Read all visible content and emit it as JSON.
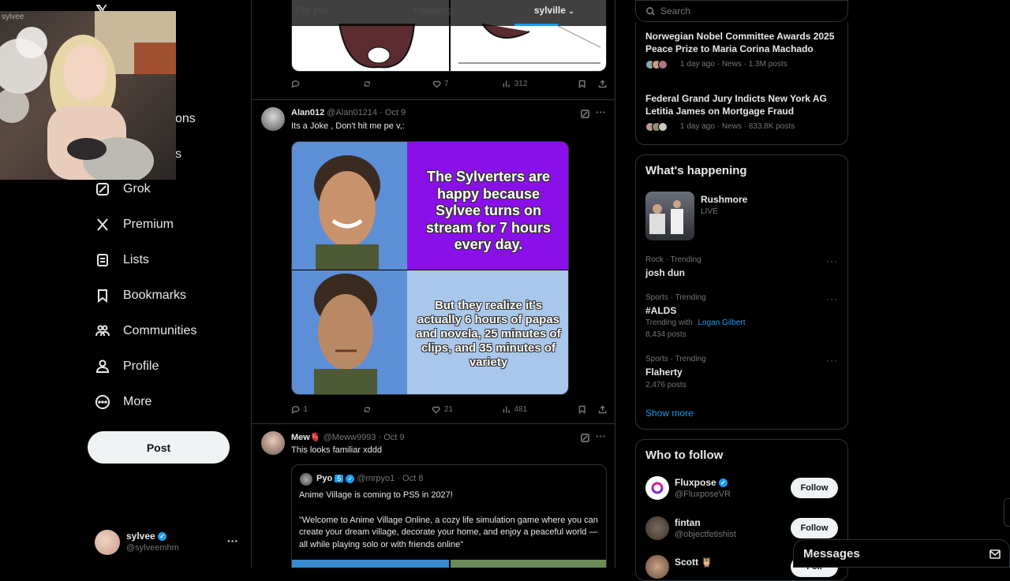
{
  "webcam": {
    "label": "sylvee"
  },
  "nav": {
    "items": [
      {
        "label": "Grok"
      },
      {
        "label": "Premium"
      },
      {
        "label": "Lists"
      },
      {
        "label": "Bookmarks"
      },
      {
        "label": "Communities"
      },
      {
        "label": "Profile"
      },
      {
        "label": "More"
      }
    ],
    "partial_1": "ons",
    "partial_2": "s",
    "post_label": "Post",
    "account": {
      "name": "sylvee",
      "handle": "@sylveemhm",
      "more": "···"
    }
  },
  "feed": {
    "tabs": [
      {
        "label": "For you"
      },
      {
        "label": "Following"
      },
      {
        "label": "sylville"
      }
    ],
    "top_actions": {
      "likes": "7",
      "views": "312"
    },
    "tweet1": {
      "name": "Alan012",
      "handle": "@Alan01214",
      "date": "· Oct 9",
      "text": "Its a Joke , Don't hit me pe v,:",
      "meme_top": "The Sylverters are happy because Sylvee turns on stream for 7 hours every day.",
      "meme_bottom": "But they realize it's actually 6 hours of papas and novela, 25 minutes of clips, and 35 minutes of variety",
      "replies": "1",
      "likes": "21",
      "views": "481"
    },
    "tweet2": {
      "name": "Mew🫀",
      "handle": "@Meww9993",
      "date": "· Oct 9",
      "text": "This looks familiar xddd",
      "quote": {
        "name": "Pyo",
        "badge": "5",
        "handle": "@mrpyo1",
        "date": "· Oct 8",
        "line1": "Anime Village is coming to PS5 in 2027!",
        "line2": "\"Welcome to Anime Village Online, a cozy life simulation game where you can create your dream village, decorate your home, and enjoy a peaceful world — all while playing solo or with friends online\""
      }
    }
  },
  "sidebar": {
    "search_placeholder": "Search",
    "news": [
      {
        "title": "Norwegian Nobel Committee Awards 2025 Peace Prize to Maria Corina Machado",
        "meta": "1 day ago · News · 1.3M posts"
      },
      {
        "title": "Federal Grand Jury Indicts New York AG Letitia James on Mortgage Fraud",
        "meta": "1 day ago · News · 833.8K posts"
      }
    ],
    "happening": {
      "title": "What's happening",
      "live": {
        "name": "Rushmore",
        "status": "LIVE"
      },
      "trends": [
        {
          "category": "Rock · Trending",
          "name": "josh dun"
        },
        {
          "category": "Sports · Trending",
          "name": "#ALDS",
          "with_prefix": "Trending with",
          "with": "Logan Gilbert",
          "posts": "8,434 posts"
        },
        {
          "category": "Sports · Trending",
          "name": "Flaherty",
          "posts": "2,476 posts"
        }
      ],
      "show_more": "Show more"
    },
    "who_to_follow": {
      "title": "Who to follow",
      "users": [
        {
          "name": "Fluxpose",
          "handle": "@FluxposeVR",
          "button": "Follow"
        },
        {
          "name": "fintan",
          "handle": "@objectfetishist",
          "button": "Follow"
        },
        {
          "name": "Scott 🦉",
          "handle": "",
          "button": "Foll"
        }
      ]
    },
    "messages_label": "Messages"
  },
  "colors": {
    "accent": "#1d9bf0",
    "meme_purple": "#8a0fe8",
    "meme_lightblue": "#a9c7ea",
    "meme_blue": "#5d8fd6"
  }
}
